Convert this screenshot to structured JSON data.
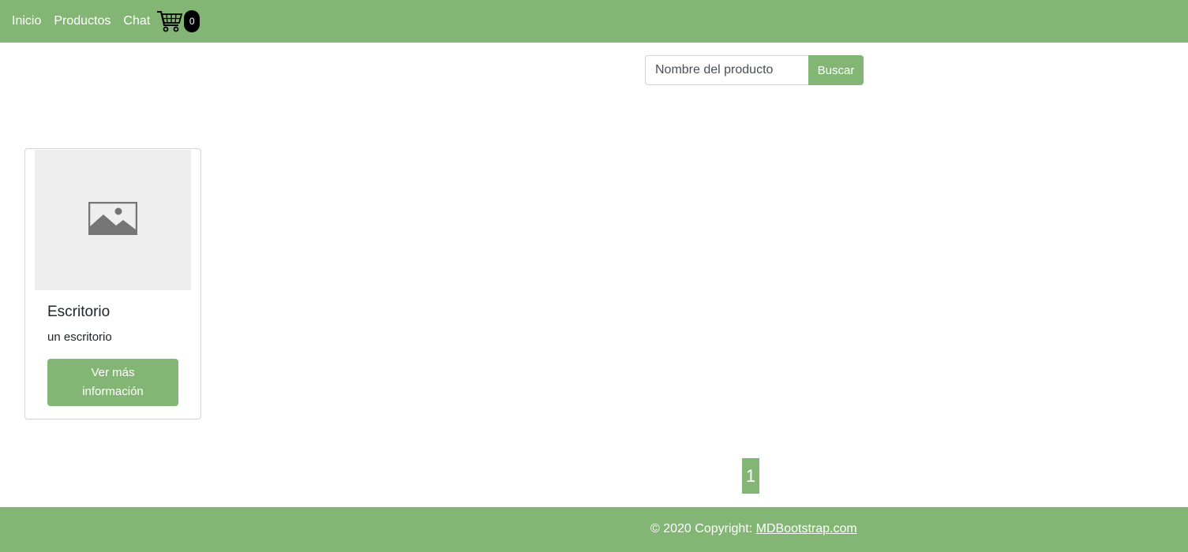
{
  "navbar": {
    "links": [
      {
        "label": "Inicio"
      },
      {
        "label": "Productos"
      },
      {
        "label": "Chat"
      }
    ],
    "cart_count": "0",
    "background_color": "#83b674"
  },
  "search": {
    "placeholder": "Nombre del producto",
    "button_label": "Buscar"
  },
  "products": [
    {
      "title": "Escritorio",
      "description": "un escritorio",
      "button_label": "Ver más información",
      "image_icon": "image-placeholder-icon"
    }
  ],
  "pagination": {
    "current_page": "1"
  },
  "footer": {
    "copyright_text": "© 2020 Copyright: ",
    "link_text": "MDBootstrap.com"
  }
}
